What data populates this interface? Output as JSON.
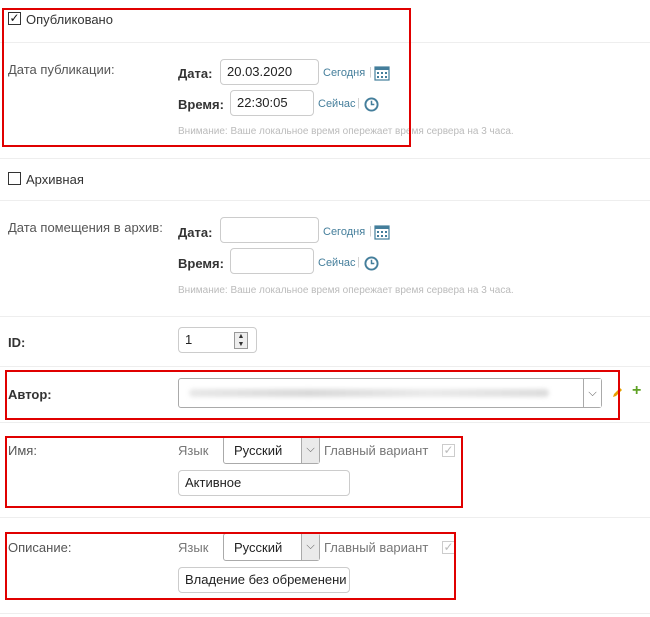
{
  "published": {
    "checkbox_label": "Опубликовано",
    "checked": true,
    "field_label": "Дата публикации:",
    "date_label": "Дата:",
    "date_value": "20.03.2020",
    "today_link": "Сегодня",
    "time_label": "Время:",
    "time_value": "22:30:05",
    "now_link": "Сейчас",
    "help_text": "Внимание: Ваше локальное время опережает время сервера на 3 часа."
  },
  "archive": {
    "checkbox_label": "Архивная",
    "checked": false,
    "field_label": "Дата помещения в архив:",
    "date_label": "Дата:",
    "date_value": "",
    "today_link": "Сегодня",
    "time_label": "Время:",
    "time_value": "",
    "now_link": "Сейчас",
    "help_text": "Внимание: Ваше локальное время опережает время сервера на 3 часа."
  },
  "id_field": {
    "label": "ID:",
    "value": "1"
  },
  "author": {
    "label": "Автор:"
  },
  "name_field": {
    "label": "Имя:",
    "lang_label": "Язык",
    "lang_value": "Русский",
    "main_variant_label": "Главный вариант",
    "value": "Активное"
  },
  "description_field": {
    "label": "Описание:",
    "lang_label": "Язык",
    "lang_value": "Русский",
    "main_variant_label": "Главный вариант",
    "value": "Владение без обременени"
  },
  "colors": {
    "link": "#447e9b",
    "highlight_box": "#e00000",
    "add_icon": "#5fa225",
    "edit_icon": "#e8a000"
  },
  "icons": {
    "calendar": "calendar-icon",
    "clock": "clock-icon",
    "edit": "pencil-icon",
    "add": "plus-icon"
  }
}
